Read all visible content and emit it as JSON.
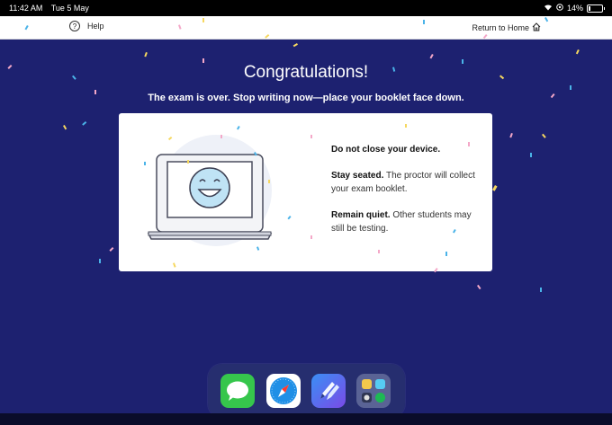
{
  "status_bar": {
    "time": "11:42 AM",
    "date": "Tue 5 May",
    "battery": "14%",
    "battery_level": 0.14
  },
  "topbar": {
    "help_label": "Help",
    "return_label": "Return to Home"
  },
  "main": {
    "title": "Congratulations!",
    "subtitle": "The exam is over. Stop writing now—place your booklet face down."
  },
  "card": {
    "note1_bold": "Do not close your device.",
    "note2_bold": "Stay seated.",
    "note2_text": " The proctor will collect your exam booklet.",
    "note3_bold": "Remain quiet.",
    "note3_text": " Other students may still be testing."
  },
  "dock": {
    "apps": [
      "Messages",
      "Safari",
      "Pencil App",
      "App Library"
    ]
  },
  "colors": {
    "background": "#1d2170",
    "card": "#ffffff",
    "face": "#bfe3f5"
  }
}
